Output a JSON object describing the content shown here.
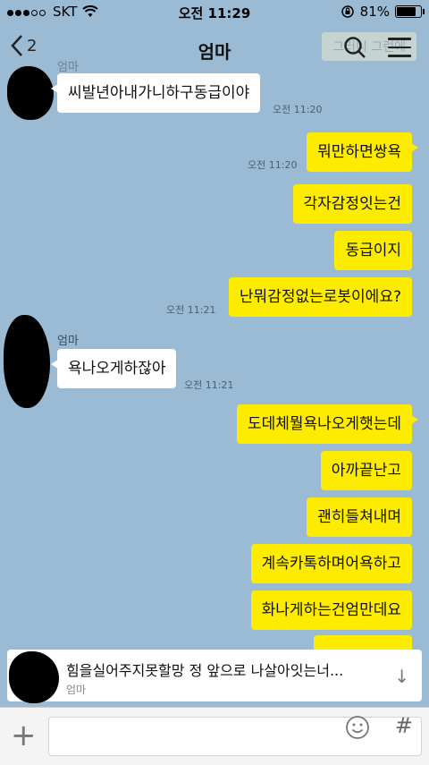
{
  "status": {
    "carrier": "SKT",
    "time": "오전 11:29",
    "battery": "81%",
    "battery_level": 0.81
  },
  "header": {
    "back_count": "2",
    "title": "엄마",
    "ghost_text": "그러니 그런에"
  },
  "messages": [
    {
      "side": "in",
      "sender": "엄마",
      "text": "씨발년아내가니하구동급이야",
      "time": "오전 11:20"
    },
    {
      "side": "out",
      "text": "뭐만하면쌍욕",
      "time": "오전 11:20"
    },
    {
      "side": "out",
      "text": "각자감정잇는건"
    },
    {
      "side": "out",
      "text": "동급이지"
    },
    {
      "side": "out",
      "text": "난뭐감정없는로봇이에요?",
      "time": "오전 11:21"
    },
    {
      "side": "in",
      "sender": "엄마",
      "text": "욕나오게하잖아",
      "time": "오전 11:21"
    },
    {
      "side": "out",
      "text": "도데체뭘욕나오게햇는데"
    },
    {
      "side": "out",
      "text": "아까끝난고"
    },
    {
      "side": "out",
      "text": "괜히들쳐내며"
    },
    {
      "side": "out",
      "text": "계속카톡하며어욕하고"
    },
    {
      "side": "out",
      "text": "화나게하는건엄만데요"
    }
  ],
  "preview": {
    "text": "힘을실어주지못할망 정  앞으로 나살아잇는너...",
    "sender": "엄마"
  },
  "input": {
    "placeholder": ""
  }
}
